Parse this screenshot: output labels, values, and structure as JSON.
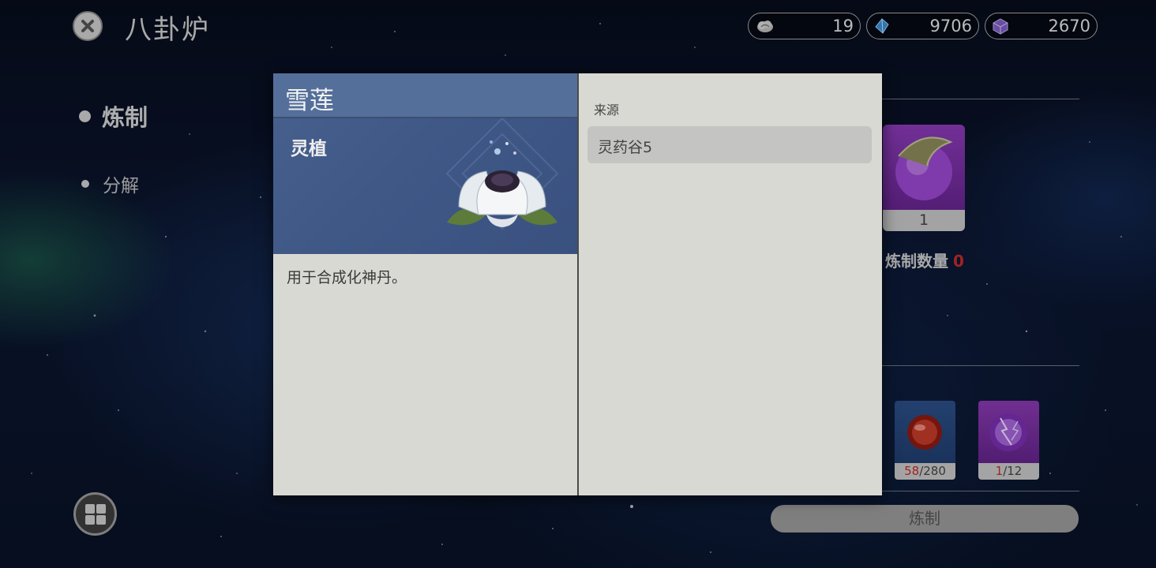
{
  "header": {
    "title": "八卦炉",
    "close_icon": "close-icon"
  },
  "currencies": [
    {
      "icon": "cloud-token-icon",
      "amount": "19"
    },
    {
      "icon": "blue-gem-icon",
      "amount": "9706"
    },
    {
      "icon": "purple-cube-icon",
      "amount": "2670"
    }
  ],
  "nav": {
    "items": [
      {
        "label": "炼制",
        "active": true
      },
      {
        "label": "分解",
        "active": false
      }
    ]
  },
  "menu_icon": "grid-menu-icon",
  "product": {
    "count": "1",
    "refine_label": "炼制数量",
    "refine_count": "0"
  },
  "materials": [
    {
      "icon": "red-orb-icon",
      "have": "58",
      "need": "/280"
    },
    {
      "icon": "purple-lightning-orb-icon",
      "have": "1",
      "need": "/12"
    }
  ],
  "refine_button": "炼制",
  "modal": {
    "item_name": "雪莲",
    "item_type": "灵植",
    "item_icon": "snow-lotus-icon",
    "description": "用于合成化神丹。",
    "source_label": "来源",
    "sources": [
      "灵药谷5"
    ]
  },
  "colors": {
    "header_blue": "#546f9a",
    "modal_bg": "#d9d9d3",
    "warning_red": "#c62a2a"
  }
}
